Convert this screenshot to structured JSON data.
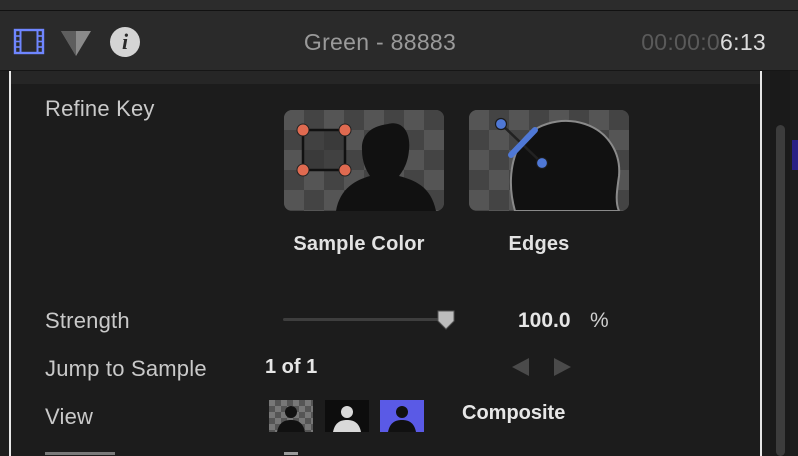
{
  "header": {
    "title": "Green - 88883",
    "timecode_dim": "00:00:0",
    "timecode_bright": "6:13"
  },
  "section": {
    "refine_key_label": "Refine Key",
    "tiles": [
      {
        "caption": "Sample Color"
      },
      {
        "caption": "Edges"
      }
    ]
  },
  "strength": {
    "label": "Strength",
    "value": "100.0",
    "unit": "%",
    "fraction": 1.0
  },
  "jump": {
    "label": "Jump to Sample",
    "value": "1 of 1"
  },
  "view": {
    "label": "View",
    "selected": "Composite"
  },
  "colors": {
    "accent_blue": "#5a5ae6",
    "handle_orange": "#e06a50",
    "edge_blue": "#4f78d6"
  },
  "icons": [
    "film-icon",
    "color-board-icon",
    "info-icon"
  ]
}
